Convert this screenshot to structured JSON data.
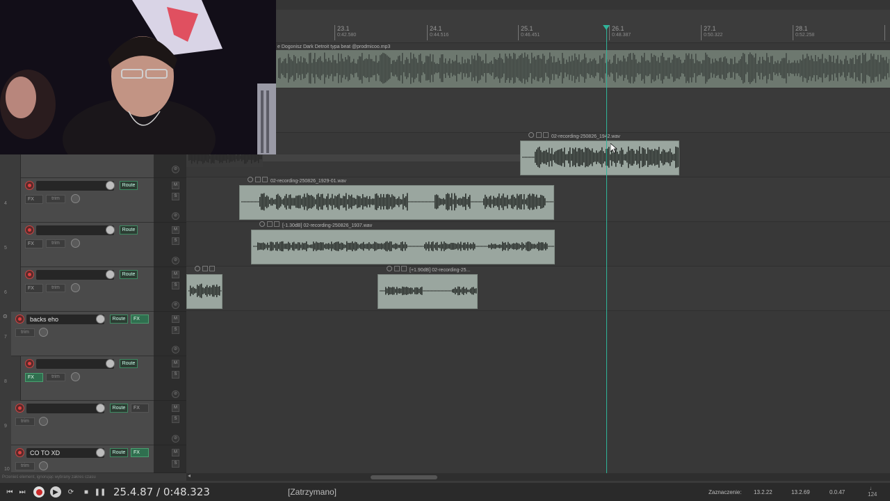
{
  "ruler": {
    "marks": [
      {
        "bar": "23.1",
        "time": "0:42.580"
      },
      {
        "bar": "24.1",
        "time": "0:44.516"
      },
      {
        "bar": "25.1",
        "time": "0:46.451"
      },
      {
        "bar": "26.1",
        "time": "0:48.387"
      },
      {
        "bar": "27.1",
        "time": "0:50.322"
      },
      {
        "bar": "28.1",
        "time": "0:52.258"
      }
    ]
  },
  "arrange": {
    "beat_item_label": "e Dogonisz Dark Detroit typa beat @prodmicoo.mp3",
    "items": {
      "rec_1942": "02-recording-250826_1942.wav",
      "rec_1929": "02-recording-250826_1929-01.wav",
      "rec_1937": "[-1.30dB] 02-recording-250826_1937.wav",
      "rec_25": "[+1.90dB] 02-recording-25..."
    }
  },
  "tracks": [
    {
      "num": "4",
      "name": "",
      "route": "Route",
      "fx": "FX",
      "trim": "trim",
      "fx_active": false
    },
    {
      "num": "5",
      "name": "",
      "route": "Route",
      "fx": "FX",
      "trim": "trim",
      "fx_active": false
    },
    {
      "num": "6",
      "name": "",
      "route": "Route",
      "fx": "FX",
      "trim": "trim",
      "fx_active": false
    },
    {
      "num": "7",
      "name": "backs eho",
      "route": "Route",
      "fx": "FX",
      "trim": "trim",
      "fx_active": true
    },
    {
      "num": "8",
      "name": "",
      "route": "Route",
      "fx": "FX",
      "trim": "trim",
      "fx_active": true
    },
    {
      "num": "9",
      "name": "",
      "route": "Route",
      "fx": "FX",
      "trim": "trim",
      "fx_active": false
    },
    {
      "num": "10",
      "name": "CO TO XD",
      "route": "Route",
      "fx": "FX",
      "trim": "trim",
      "fx_active": true
    }
  ],
  "ms": {
    "mute": "M",
    "solo": "S"
  },
  "status_hint": "Przenieś element, ignorując wybrany zakres czasu",
  "transport": {
    "position": "25.4.87 / 0:48.323",
    "state": "[Zatrzymano]",
    "selection_label": "Zaznaczenie:",
    "sel_start": "13.2.22",
    "sel_end": "13.2.69",
    "sel_len": "0.0.47",
    "bpm": "124"
  },
  "colors": {
    "accent": "#2fb59a",
    "item": "#9aa69f",
    "record": "#cc2a2a"
  }
}
